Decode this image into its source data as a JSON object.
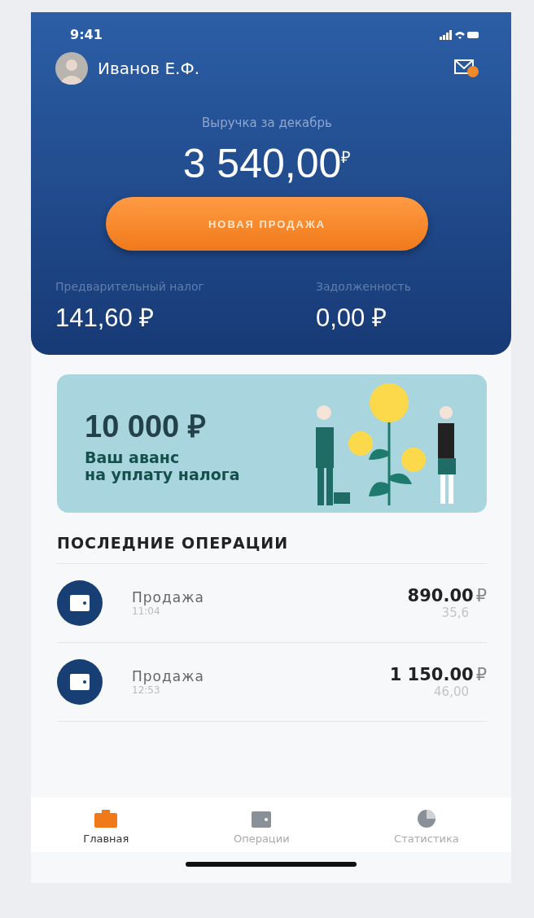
{
  "status_bar": {
    "time": "9:41"
  },
  "user": {
    "name": "Иванов Е.Ф."
  },
  "revenue": {
    "label": "Выручка за декабрь",
    "amount": "3 540,00",
    "currency": "₽"
  },
  "new_sale_button": "НОВАЯ ПРОДАЖА",
  "summary": [
    {
      "label": "Предварительный налог",
      "value": "141,60 ₽"
    },
    {
      "label": "Задолженность",
      "value": "0,00 ₽"
    }
  ],
  "promo": {
    "amount": "10 000 ₽",
    "text": "Ваш аванс\nна уплату налога"
  },
  "operations": {
    "title": "ПОСЛЕДНИЕ ОПЕРАЦИИ",
    "items": [
      {
        "name": "Продажа",
        "time": "11:04",
        "amount": "890.00",
        "currency": "₽",
        "tax": "35,6"
      },
      {
        "name": "Продажа",
        "time": "12:53",
        "amount": "1 150.00",
        "currency": "₽",
        "tax": "46,00"
      }
    ]
  },
  "tab_bar": [
    {
      "label": "Главная",
      "kind": "home",
      "selected": true
    },
    {
      "label": "Операции",
      "kind": "operations",
      "selected": false
    },
    {
      "label": "Статистика",
      "kind": "stats",
      "selected": false
    }
  ]
}
